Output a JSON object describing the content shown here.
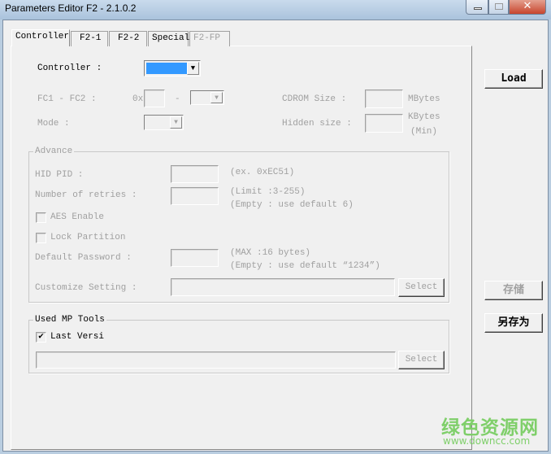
{
  "window": {
    "title": "Parameters Editor F2 - 2.1.0.2"
  },
  "tabs": [
    {
      "label": "Controller"
    },
    {
      "label": "F2-1"
    },
    {
      "label": "F2-2"
    },
    {
      "label": "Special"
    },
    {
      "label": "F2-FP"
    }
  ],
  "controller": {
    "label": "Controller :",
    "selected": ""
  },
  "fc": {
    "label": "FC1 - FC2 :",
    "prefix": "0x",
    "dash": "-"
  },
  "mode": {
    "label": "Mode :"
  },
  "cdrom": {
    "label": "CDROM Size :",
    "unit": "MBytes"
  },
  "hidden": {
    "label": "Hidden size :",
    "unit1": "KBytes",
    "unit2": "(Min)"
  },
  "advance": {
    "title": "Advance",
    "hid_pid": {
      "label": "HID PID :",
      "hint": "(ex. 0xEC51)"
    },
    "retries": {
      "label": "Number of retries :",
      "hint1": "(Limit :3-255)",
      "hint2": "(Empty : use default 6)"
    },
    "aes": {
      "label": "AES Enable",
      "checked": false
    },
    "lock": {
      "label": "Lock Partition",
      "checked": false
    },
    "password": {
      "label": "Default Password :",
      "hint1": "(MAX :16 bytes)",
      "hint2": "(Empty : use default “1234”)"
    },
    "customize": {
      "label": "Customize Setting :",
      "select": "Select"
    }
  },
  "mp_tools": {
    "title": "Used MP Tools",
    "last_version": {
      "label": "Last Versi",
      "checked": true,
      "mark": "✔"
    },
    "select": "Select"
  },
  "buttons": {
    "load": "Load",
    "save": "存储",
    "save_as": "另存为"
  },
  "watermark": {
    "cn": "绿色资源网",
    "url": "www.downcc.com"
  },
  "colors": {
    "selection": "#3399ff",
    "watermark": "#7fcf6a"
  }
}
